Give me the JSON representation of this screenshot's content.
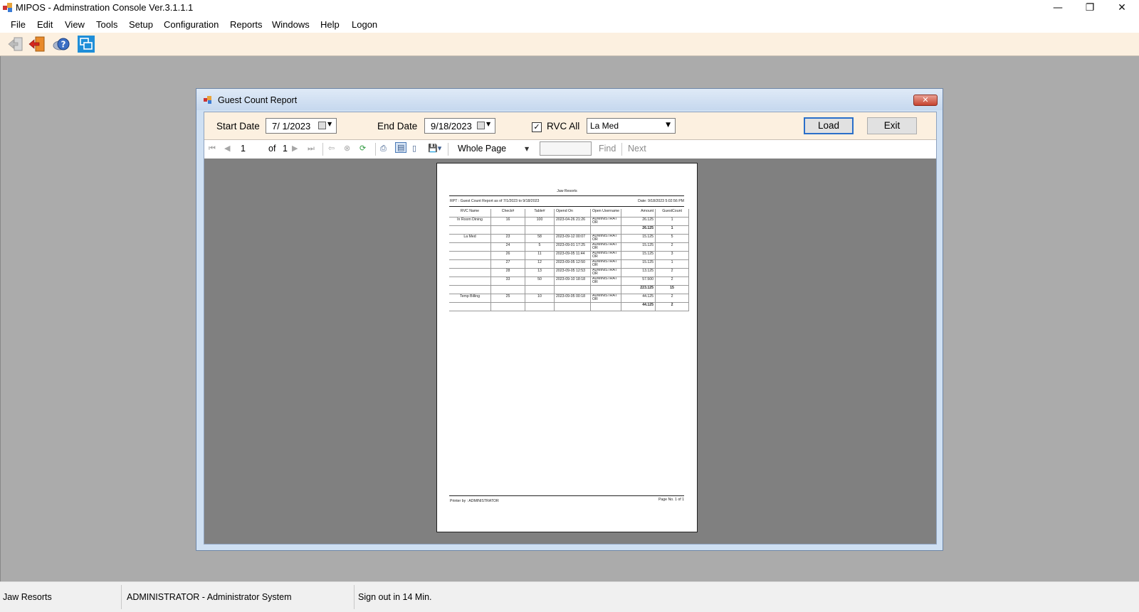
{
  "window": {
    "title": "MIPOS - Adminstration Console Ver.3.1.1.1",
    "controls": {
      "minimize": "—",
      "restore": "❐",
      "close": "✕"
    }
  },
  "menu": [
    "File",
    "Edit",
    "View",
    "Tools",
    "Setup",
    "Configuration",
    "Reports",
    "Windows",
    "Help",
    "Logon"
  ],
  "toolbar": {
    "buttons": [
      "back-arrow-icon",
      "exit-door-icon",
      "help-icon",
      "window-switch-icon"
    ]
  },
  "dialog": {
    "title": "Guest Count Report",
    "close_glyph": "✕",
    "filters": {
      "start_date_label": "Start Date",
      "start_date_value": "7/ 1/2023",
      "end_date_label": "End Date",
      "end_date_value": "9/18/2023",
      "rvc_all_label": "RVC All",
      "rvc_all_checked": true,
      "rvc_check_glyph": "✓",
      "rvc_selected": "La Med",
      "load_label": "Load",
      "exit_label": "Exit"
    },
    "viewer": {
      "page_current": "1",
      "page_of": "of",
      "page_total": "1",
      "zoom": "Whole Page",
      "find_label": "Find",
      "next_label": "Next"
    }
  },
  "report": {
    "company": "Jaw Resorts",
    "heading": "RPT : Guest Count Report as of 7/1/2023 to 9/18/2023",
    "date": "Date: 9/18/2023 5:02:56 PM",
    "columns": [
      "RVC Name",
      "Check#",
      "Table#",
      "Opend On",
      "Open Username",
      "Amount",
      "GuestCount"
    ],
    "rows": [
      {
        "rvc": "In Room Dining",
        "check": "16",
        "table": "100",
        "opened": "2023-04-26 21:26",
        "user": "ADMINISTRAT OR",
        "amount": "26.125",
        "guests": "1"
      },
      {
        "rvc": "",
        "check": "",
        "table": "",
        "opened": "",
        "user": "",
        "amount": "26.125",
        "guests": "1",
        "subtotal": true
      },
      {
        "rvc": "La Med",
        "check": "23",
        "table": "58",
        "opened": "2023-09-12 00:07",
        "user": "ADMINISTRAT OR",
        "amount": "15.125",
        "guests": "5"
      },
      {
        "rvc": "",
        "check": "24",
        "table": "5",
        "opened": "2023-09-01 17:25",
        "user": "ADMINISTRAT OR",
        "amount": "15.125",
        "guests": "2"
      },
      {
        "rvc": "",
        "check": "26",
        "table": "11",
        "opened": "2023-09-05 11:44",
        "user": "ADMINISTRAT OR",
        "amount": "15.125",
        "guests": "3"
      },
      {
        "rvc": "",
        "check": "27",
        "table": "12",
        "opened": "2023-09-05 12:50",
        "user": "ADMINISTRAT OR",
        "amount": "15.125",
        "guests": "1"
      },
      {
        "rvc": "",
        "check": "28",
        "table": "13",
        "opened": "2023-09-05 12:53",
        "user": "ADMINISTRAT OR",
        "amount": "13.125",
        "guests": "2"
      },
      {
        "rvc": "",
        "check": "33",
        "table": "50",
        "opened": "2023-09-10 18:18",
        "user": "ADMINISTRAT OR",
        "amount": "57.500",
        "guests": "2"
      },
      {
        "rvc": "",
        "check": "",
        "table": "",
        "opened": "",
        "user": "",
        "amount": "223.125",
        "guests": "15",
        "subtotal": true
      },
      {
        "rvc": "Temp Billing",
        "check": "25",
        "table": "10",
        "opened": "2023-09-05 00:18",
        "user": "ADMINISTRAT OR",
        "amount": "44.125",
        "guests": "2"
      },
      {
        "rvc": "",
        "check": "",
        "table": "",
        "opened": "",
        "user": "",
        "amount": "44.125",
        "guests": "2",
        "subtotal": true
      }
    ],
    "printed_by": "Printer by : ADMINISTRATOR",
    "page_no": "Page No. 1 of 1"
  },
  "status": {
    "company": "Jaw Resorts",
    "user": "ADMINISTRATOR - Administrator System",
    "signout": "Sign out in 14 Min."
  }
}
